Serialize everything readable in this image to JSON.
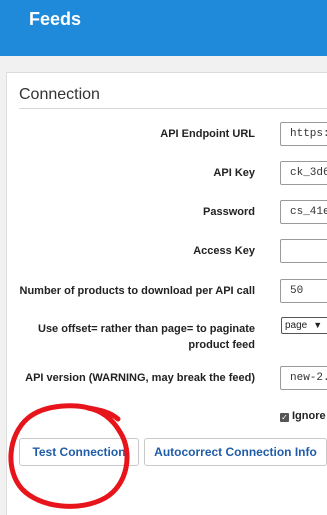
{
  "header": {
    "title": "Feeds"
  },
  "section": {
    "title": "Connection"
  },
  "fields": {
    "api_endpoint": {
      "label": "API Endpoint URL",
      "value": "https://"
    },
    "api_key": {
      "label": "API Key",
      "value": "ck_3d6"
    },
    "password": {
      "label": "Password",
      "value": "cs_41e"
    },
    "access_key": {
      "label": "Access Key",
      "value": ""
    },
    "per_call": {
      "label": "Number of products to download per API call",
      "value": "50"
    },
    "offset": {
      "label_line1": "Use offset= rather than page= to paginate",
      "label_line2": "product feed",
      "value": "page"
    },
    "api_version": {
      "label": "API version (WARNING, may break the feed)",
      "value": "new-2."
    }
  },
  "ignore_checkbox": {
    "label": "Ignore",
    "checked": true
  },
  "buttons": {
    "test_connection": "Test Connection",
    "autocorrect": "Autocorrect Connection Info"
  },
  "colors": {
    "header": "#1f8ad9",
    "button_text": "#1f5da8",
    "annotation": "#e8141b"
  }
}
